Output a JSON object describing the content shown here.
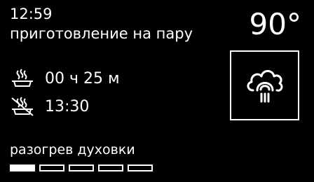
{
  "header": {
    "clock": "12:59",
    "mode": "приготовление на пару",
    "temperature": "90°"
  },
  "info": {
    "duration": {
      "icon": "cooking-pot-icon",
      "value": "00 ч 25 м"
    },
    "end_time": {
      "icon": "pot-crossed-icon",
      "value": "13:30"
    }
  },
  "program_icon": "steam-cloud-icon",
  "status": {
    "label": "разогрев духовки",
    "progress_steps_total": 5,
    "progress_steps_done": 1
  }
}
